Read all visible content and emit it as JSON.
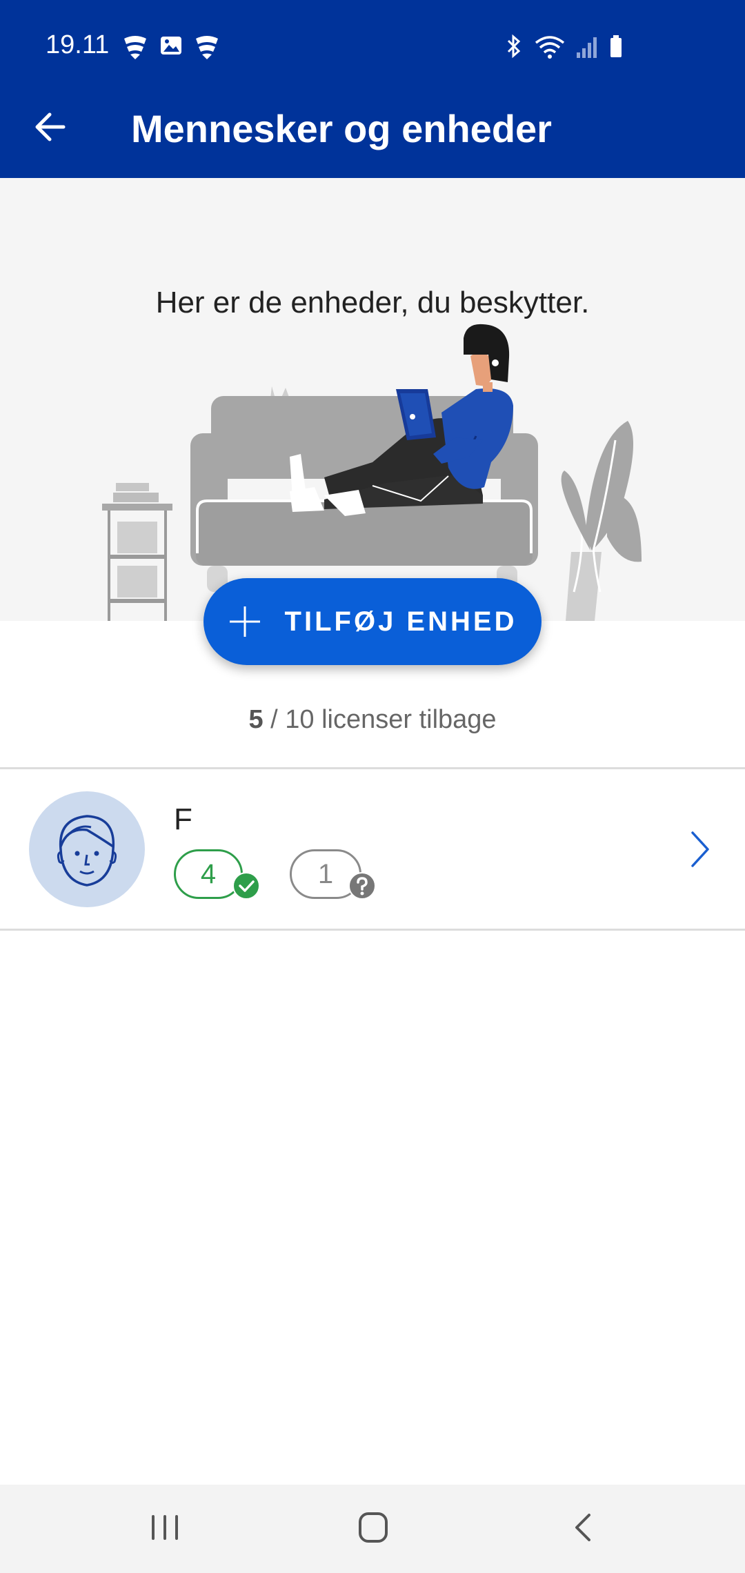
{
  "status_bar": {
    "time": "19.11"
  },
  "app_bar": {
    "title": "Mennesker og enheder"
  },
  "hero": {
    "text": "Her er de enheder, du beskytter."
  },
  "add_button": {
    "label": "TILFØJ ENHED"
  },
  "licenses": {
    "remaining": "5",
    "rest": " / 10 licenser tilbage"
  },
  "person": {
    "name": "F",
    "protected_count": "4",
    "unknown_count": "1"
  },
  "colors": {
    "app_bar": "#00339a",
    "accent_button": "#0a5fd8",
    "ok_green": "#2e9e4a",
    "avatar_bg": "#ccdaee"
  }
}
